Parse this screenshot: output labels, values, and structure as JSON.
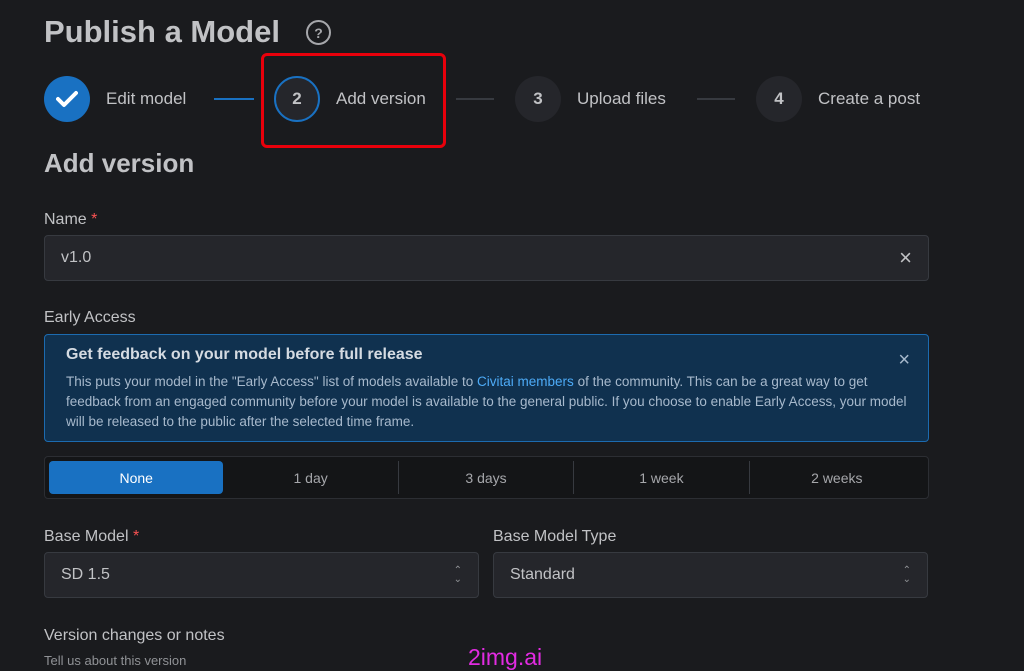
{
  "page": {
    "title": "Publish a Model",
    "help_icon": "question-circle-icon"
  },
  "stepper": {
    "steps": [
      {
        "number": "1",
        "label": "Edit model",
        "state": "completed"
      },
      {
        "number": "2",
        "label": "Add version",
        "state": "active"
      },
      {
        "number": "3",
        "label": "Upload files",
        "state": "pending"
      },
      {
        "number": "4",
        "label": "Create a post",
        "state": "pending"
      }
    ]
  },
  "section": {
    "title": "Add version"
  },
  "name_field": {
    "label": "Name",
    "required": "*",
    "value": "v1.0"
  },
  "early_access": {
    "label": "Early Access",
    "alert_title": "Get feedback on your model before full release",
    "alert_text_1": "This puts your model in the \"Early Access\" list of models available to ",
    "alert_link": "Civitai members",
    "alert_text_2": " of the community. This can be a great way to get feedback from an engaged community before your model is available to the general public. If you choose to enable Early Access, your model will be released to the public after the selected time frame.",
    "options": [
      "None",
      "1 day",
      "3 days",
      "1 week",
      "2 weeks"
    ],
    "selected": "None"
  },
  "base_model": {
    "label": "Base Model",
    "required": "*",
    "value": "SD 1.5"
  },
  "base_model_type": {
    "label": "Base Model Type",
    "value": "Standard"
  },
  "notes": {
    "label": "Version changes or notes",
    "description": "Tell us about this version"
  },
  "watermark": "2img.ai",
  "colors": {
    "accent": "#1971c2",
    "highlight_box": "#e8000b",
    "background": "#1a1b1e"
  }
}
